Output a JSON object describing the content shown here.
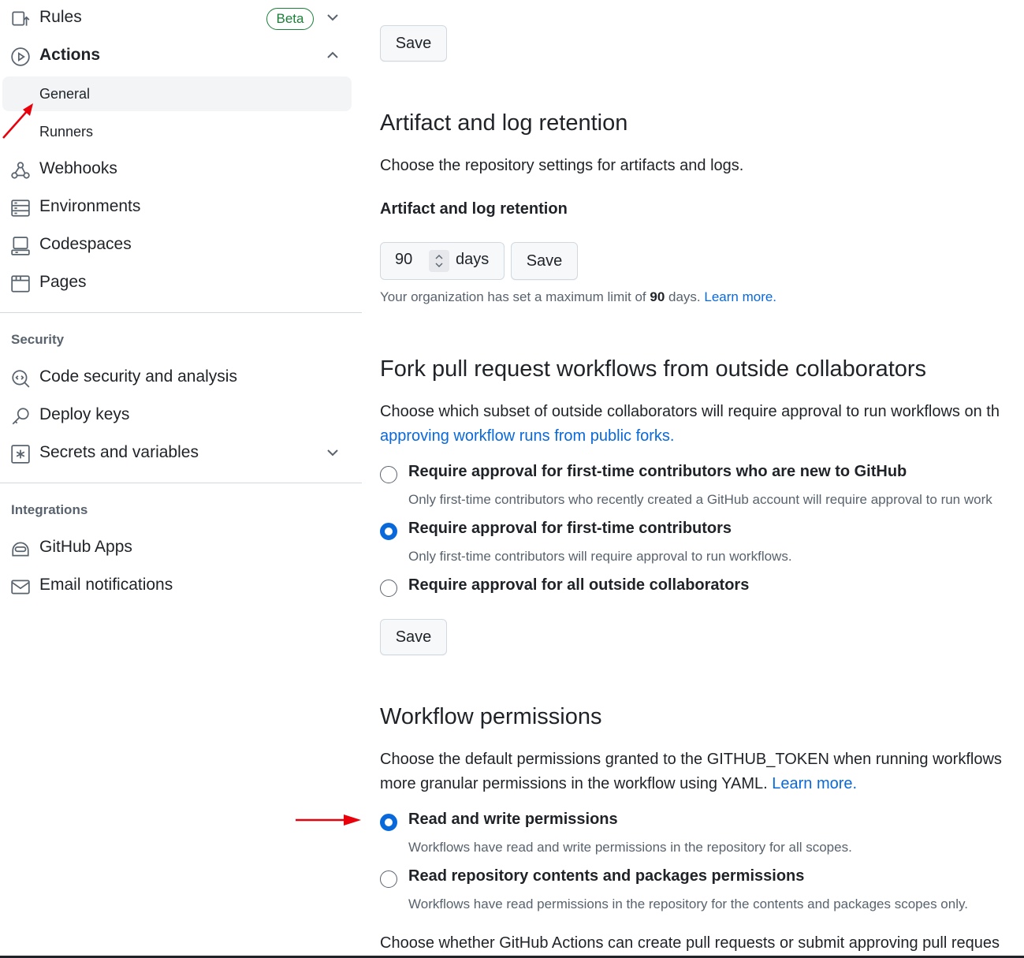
{
  "sidebar": {
    "items": [
      {
        "label": "Rules",
        "badge": "Beta",
        "icon": "rules-icon"
      },
      {
        "label": "Actions",
        "icon": "play-icon"
      },
      {
        "label": "General"
      },
      {
        "label": "Runners"
      },
      {
        "label": "Webhooks",
        "icon": "webhook-icon"
      },
      {
        "label": "Environments",
        "icon": "server-icon"
      },
      {
        "label": "Codespaces",
        "icon": "codespaces-icon"
      },
      {
        "label": "Pages",
        "icon": "browser-icon"
      }
    ],
    "security": {
      "title": "Security",
      "items": [
        {
          "label": "Code security and analysis",
          "icon": "codescan-icon"
        },
        {
          "label": "Deploy keys",
          "icon": "key-icon"
        },
        {
          "label": "Secrets and variables",
          "icon": "asterisk-icon"
        }
      ]
    },
    "integrations": {
      "title": "Integrations",
      "items": [
        {
          "label": "GitHub Apps",
          "icon": "hubot-icon"
        },
        {
          "label": "Email notifications",
          "icon": "mail-icon"
        }
      ]
    }
  },
  "main": {
    "top_save": "Save",
    "artifact": {
      "title": "Artifact and log retention",
      "description": "Choose the repository settings for artifacts and logs.",
      "subtitle": "Artifact and log retention",
      "days_value": "90",
      "days_unit": "days",
      "save": "Save",
      "note_prefix": "Your organization has set a maximum limit of ",
      "note_limit": "90",
      "note_suffix": " days. ",
      "note_link": "Learn more."
    },
    "fork": {
      "title": "Fork pull request workflows from outside collaborators",
      "description": "Choose which subset of outside collaborators will require approval to run workflows on th",
      "description_link": "approving workflow runs from public forks.",
      "options": [
        {
          "label": "Require approval for first-time contributors who are new to GitHub",
          "note": "Only first-time contributors who recently created a GitHub account will require approval to run work",
          "checked": false
        },
        {
          "label": "Require approval for first-time contributors",
          "note": "Only first-time contributors will require approval to run workflows.",
          "checked": true
        },
        {
          "label": "Require approval for all outside collaborators",
          "note": "",
          "checked": false
        }
      ],
      "save": "Save"
    },
    "workflow": {
      "title": "Workflow permissions",
      "description_line1": "Choose the default permissions granted to the GITHUB_TOKEN when running workflows",
      "description_line2": "more granular permissions in the workflow using YAML. ",
      "description_link": "Learn more.",
      "options": [
        {
          "label": "Read and write permissions",
          "note": "Workflows have read and write permissions in the repository for all scopes.",
          "checked": true
        },
        {
          "label": "Read repository contents and packages permissions",
          "note": "Workflows have read permissions in the repository for the contents and packages scopes only.",
          "checked": false
        }
      ],
      "footer": "Choose whether GitHub Actions can create pull requests or submit approving pull reques"
    }
  },
  "colors": {
    "accent": "#0969da",
    "annotation": "#e8000b",
    "beta": "#1a7f37"
  }
}
